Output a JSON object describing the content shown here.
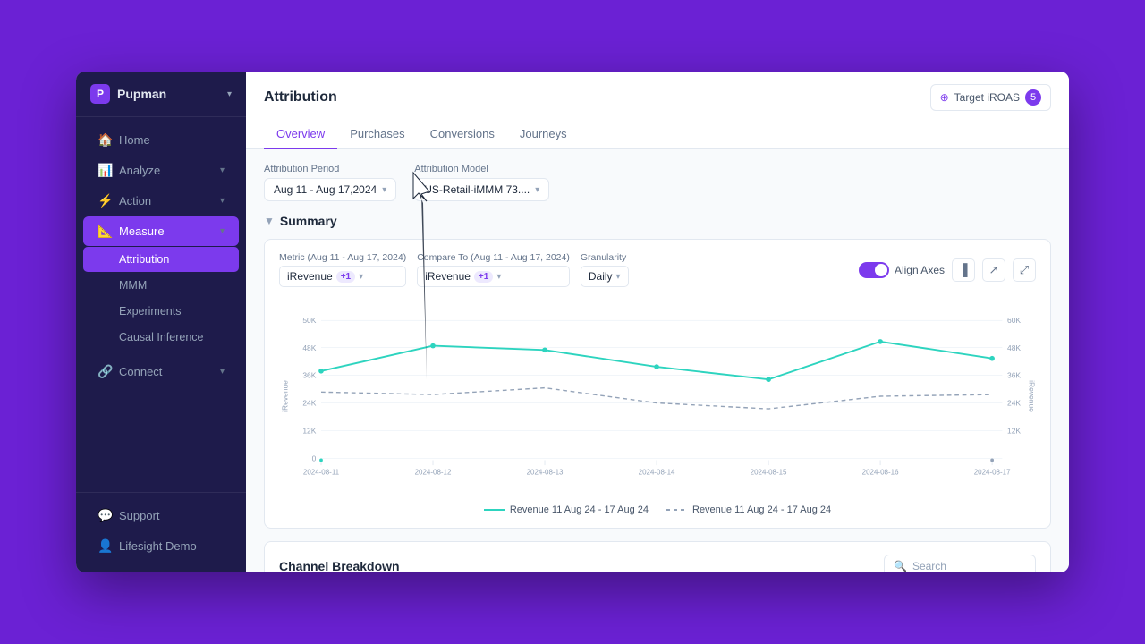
{
  "app": {
    "name": "Pupman",
    "logo_letter": "P"
  },
  "sidebar": {
    "nav_items": [
      {
        "id": "home",
        "label": "Home",
        "icon": "🏠",
        "has_chevron": false,
        "active": false
      },
      {
        "id": "analyze",
        "label": "Analyze",
        "icon": "📊",
        "has_chevron": true,
        "active": false
      },
      {
        "id": "action",
        "label": "Action",
        "icon": "⚡",
        "has_chevron": true,
        "active": false
      },
      {
        "id": "measure",
        "label": "Measure",
        "icon": "📐",
        "has_chevron": true,
        "active": true
      }
    ],
    "sub_items": [
      {
        "id": "attribution",
        "label": "Attribution",
        "active": true
      },
      {
        "id": "mmm",
        "label": "MMM",
        "active": false
      },
      {
        "id": "experiments",
        "label": "Experiments",
        "active": false
      },
      {
        "id": "causal-inference",
        "label": "Causal Inference",
        "active": false
      }
    ],
    "footer_items": [
      {
        "id": "connect",
        "label": "Connect",
        "icon": "🔗",
        "has_chevron": true
      },
      {
        "id": "support",
        "label": "Support",
        "icon": "💬"
      },
      {
        "id": "user",
        "label": "Lifesight Demo",
        "icon": "👤"
      }
    ]
  },
  "page": {
    "title": "Attribution",
    "target_roas_label": "Target iROAS",
    "target_roas_value": "5"
  },
  "tabs": [
    {
      "id": "overview",
      "label": "Overview",
      "active": true
    },
    {
      "id": "purchases",
      "label": "Purchases",
      "active": false
    },
    {
      "id": "conversions",
      "label": "Conversions",
      "active": false
    },
    {
      "id": "journeys",
      "label": "Journeys",
      "active": false
    }
  ],
  "filters": {
    "attribution_period": {
      "label": "Attribution Period",
      "value": "Aug 11 - Aug 17,2024"
    },
    "attribution_model": {
      "label": "Attribution Model",
      "value": "US-Retail-iMMM 73...."
    }
  },
  "summary": {
    "title": "Summary"
  },
  "chart": {
    "metric_label": "Metric (Aug 11 - Aug 17, 2024)",
    "metric_value": "iRevenue",
    "metric_badge": "+1",
    "compare_label": "Compare To (Aug 11 - Aug 17, 2024)",
    "compare_value": "iRevenue",
    "compare_badge": "+1",
    "granularity_label": "Granularity",
    "granularity_value": "Daily",
    "align_axes_label": "Align Axes",
    "align_axes_on": true,
    "y_axis_label": "iRevenue",
    "y_axis_label_right": "iRevenue",
    "y_left": [
      "50K",
      "48K",
      "36K",
      "24K",
      "12K",
      "0"
    ],
    "y_right": [
      "60K",
      "48K",
      "36K",
      "24K",
      "12K"
    ],
    "x_labels": [
      "2024-08-11",
      "2024-08-12",
      "2024-08-13",
      "2024-08-14",
      "2024-08-15",
      "2024-08-16",
      "2024-08-17"
    ],
    "legend": [
      {
        "id": "solid",
        "label": "Revenue 11 Aug 24 - 17 Aug 24",
        "style": "solid"
      },
      {
        "id": "dashed",
        "label": "Revenue 11 Aug 24 - 17 Aug 24",
        "style": "dashed"
      }
    ]
  },
  "channel_breakdown": {
    "title": "Channel Breakdown",
    "search_placeholder": "Search"
  }
}
